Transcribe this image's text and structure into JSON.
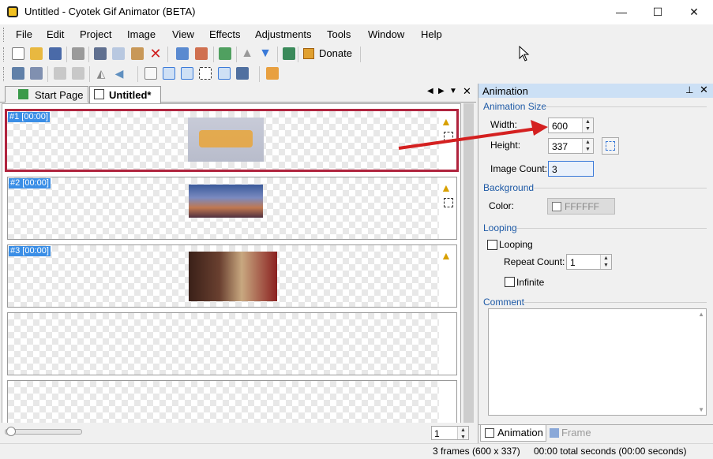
{
  "window": {
    "title": "Untitled - Cyotek Gif Animator (BETA)",
    "minimize": "—",
    "maximize": "☐",
    "close": "✕"
  },
  "menu": [
    "File",
    "Edit",
    "Project",
    "Image",
    "View",
    "Effects",
    "Adjustments",
    "Tools",
    "Window",
    "Help"
  ],
  "toolbar": {
    "donate_label": "Donate"
  },
  "doc_tabs": {
    "start_page": "Start Page",
    "untitled": "Untitled*"
  },
  "frames": [
    {
      "label": "#1 [00:00]"
    },
    {
      "label": "#2 [00:00]"
    },
    {
      "label": "#3 [00:00]"
    }
  ],
  "frame_spinner": {
    "value": "1"
  },
  "panel": {
    "title": "Animation",
    "animation_size": "Animation Size",
    "width_label": "Width:",
    "width_value": "600",
    "height_label": "Height:",
    "height_value": "337",
    "image_count_label": "Image Count:",
    "image_count_value": "3",
    "background": "Background",
    "color_label": "Color:",
    "color_value": "FFFFFF",
    "looping": "Looping",
    "looping_checkbox": "Looping",
    "repeat_count_label": "Repeat Count:",
    "repeat_count_value": "1",
    "infinite_checkbox": "Infinite",
    "comment": "Comment",
    "tab_animation": "Animation",
    "tab_frame": "Frame"
  },
  "status": {
    "left": "3 frames (600 x 337)",
    "right": "00:00 total seconds (00:00 seconds)"
  },
  "colors": {
    "accent": "#3a8ee6",
    "selection_border": "#b0243e",
    "arrow": "#d42020",
    "panel_header": "#cce0f5"
  }
}
